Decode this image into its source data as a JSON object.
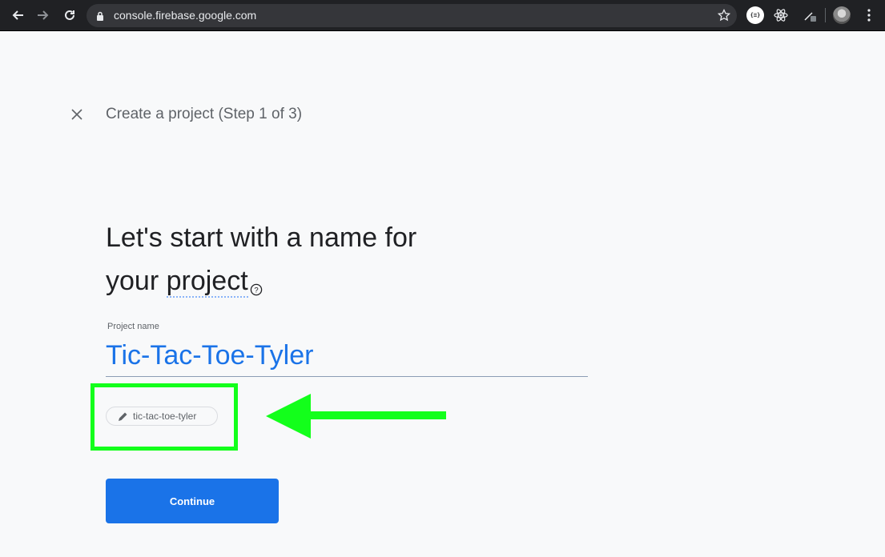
{
  "browser": {
    "url": "console.firebase.google.com",
    "extension_json_label": "{≡}"
  },
  "header": {
    "step_title": "Create a project (Step 1 of 3)"
  },
  "main": {
    "headline_line1": "Let's start with a name for",
    "headline_line2_prefix": "your",
    "headline_term": "project",
    "help_symbol": "?",
    "field_label": "Project name",
    "project_name_value": "Tic-Tac-Toe-Tyler",
    "project_id": "tic-tac-toe-tyler",
    "continue_label": "Continue"
  },
  "colors": {
    "accent": "#1a73e8",
    "annotation": "#13ff1b",
    "browser_chrome": "#202124"
  }
}
